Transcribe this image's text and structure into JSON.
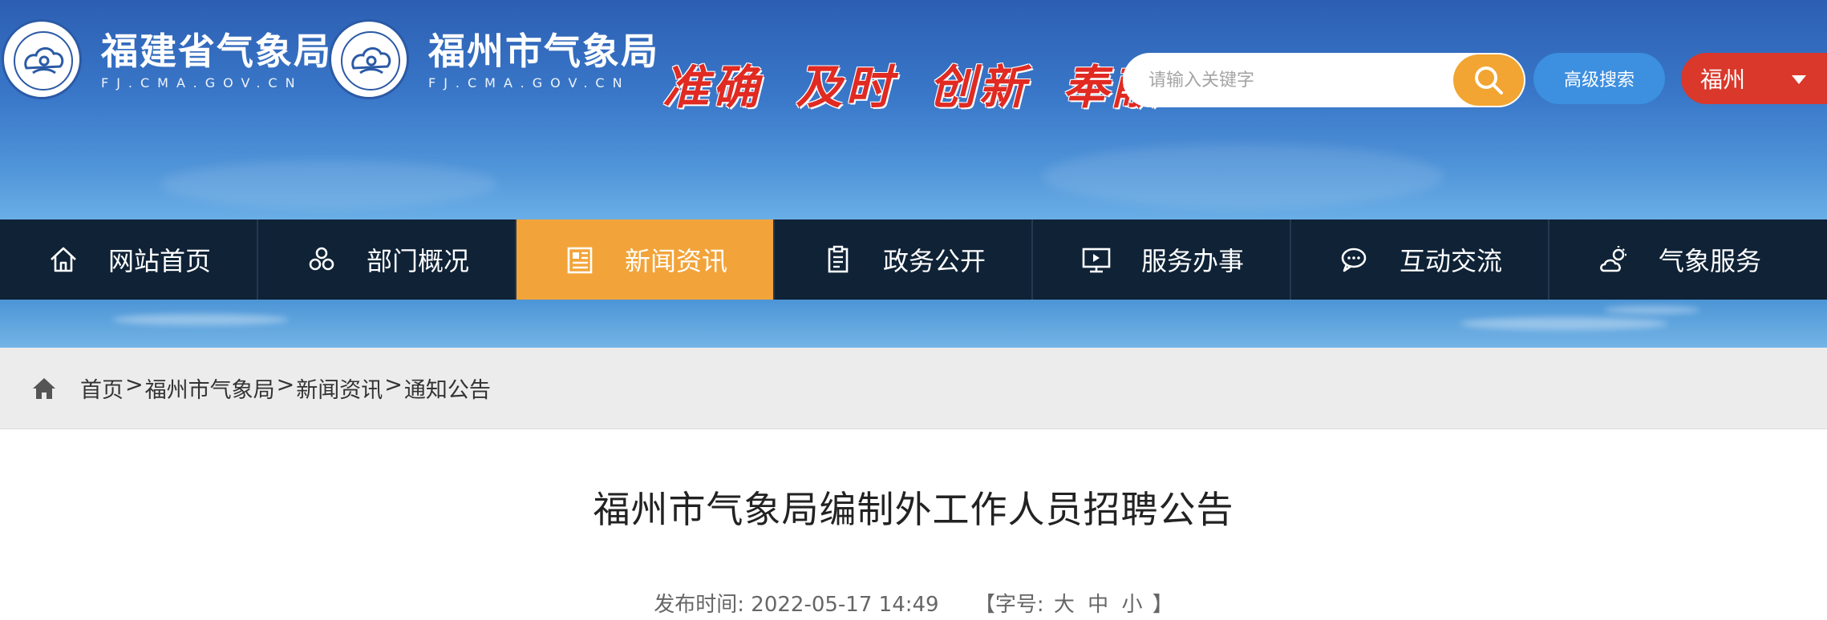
{
  "header": {
    "logo1": {
      "cn": "福建省气象局",
      "en": "FJ.CMA.GOV.CN"
    },
    "logo2": {
      "cn": "福州市气象局",
      "en": "FJ.CMA.GOV.CN"
    },
    "slogan": "准确 及时 创新 奉献",
    "search": {
      "placeholder": "请输入关键字"
    },
    "advanced_search_label": "高级搜索",
    "city": {
      "selected": "福州"
    }
  },
  "nav": {
    "items": [
      {
        "label": "网站首页",
        "icon": "home-icon",
        "active": false
      },
      {
        "label": "部门概况",
        "icon": "department-icon",
        "active": false
      },
      {
        "label": "新闻资讯",
        "icon": "news-icon",
        "active": true
      },
      {
        "label": "政务公开",
        "icon": "clipboard-icon",
        "active": false
      },
      {
        "label": "服务办事",
        "icon": "monitor-icon",
        "active": false
      },
      {
        "label": "互动交流",
        "icon": "chat-icon",
        "active": false
      },
      {
        "label": "气象服务",
        "icon": "weather-icon",
        "active": false
      }
    ]
  },
  "breadcrumb": {
    "items": [
      "首页",
      "福州市气象局",
      "新闻资讯",
      "通知公告"
    ],
    "separator": ">"
  },
  "article": {
    "title": "福州市气象局编制外工作人员招聘公告",
    "publish_label": "发布时间:",
    "publish_time": "2022-05-17 14:49",
    "font_size_open": "【字号:",
    "font_large": "大",
    "font_medium": "中",
    "font_small": "小",
    "font_size_close": "】"
  },
  "colors": {
    "nav_bg": "#0f2236",
    "nav_active": "#f2a43a",
    "search_button": "#f2a532",
    "advanced_button": "#3d8fe0",
    "city_select": "#d9382b",
    "slogan": "#e02a22"
  }
}
